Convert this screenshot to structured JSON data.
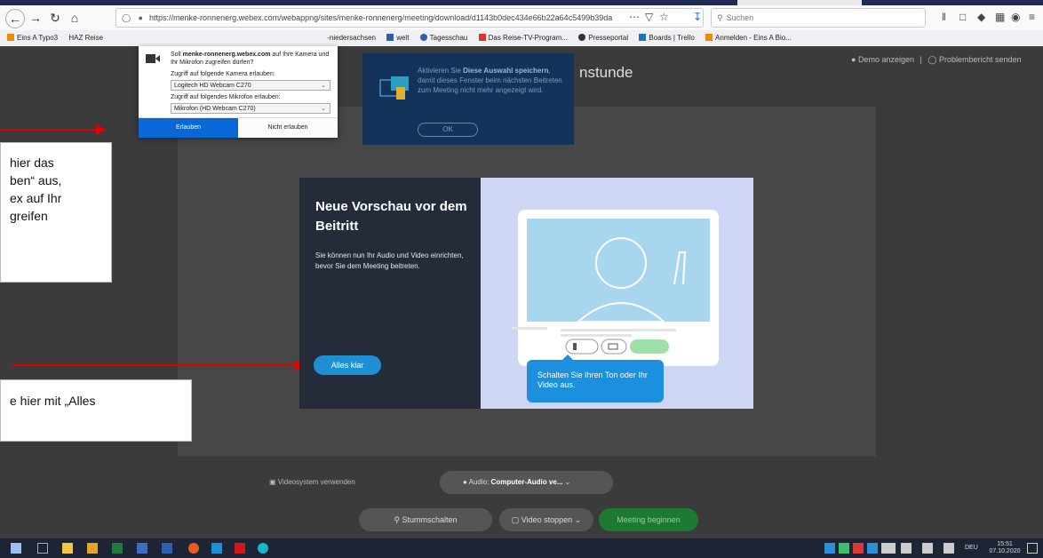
{
  "browser": {
    "url": "https://menke-ronnenerg.webex.com/webappng/sites/menke-ronnenerg/meeting/download/d1143b0dec434e66b22a64c5499b39da",
    "search_placeholder": "Suchen",
    "bookmarks": [
      "Eins A Typo3",
      "HAZ Reise",
      "-niedersachsen",
      "welt",
      "Tagesschau",
      "Das Reise-TV-Program...",
      "Presseportal",
      "Boards | Trello",
      "Anmelden - Eins A Bio..."
    ]
  },
  "permission_popup": {
    "message_prefix": "Soll",
    "message_domain": "menke-ronnenerg.webex.com",
    "message_suffix": "auf Ihre Kamera und Ihr Mikrofon zugreifen dürfen?",
    "camera_label": "Zugriff auf folgende Kamera erlauben:",
    "camera_value": "Logitech HD Webcam C270",
    "mic_label": "Zugriff auf folgendes Mikrofon erlauben:",
    "mic_value": "Mikrofon (HD Webcam C270)",
    "allow": "Erlauben",
    "deny": "Nicht erlauben"
  },
  "tip": {
    "text_prefix": "Aktivieren Sie",
    "text_bold": "Diese Auswahl speichern",
    "text_suffix": ", damit dieses Fenster beim nächsten Beitreten zum Meeting nicht mehr angezeigt wird.",
    "ok": "OK"
  },
  "page": {
    "title_fragment": "nstunde",
    "demo_link": "Demo anzeigen",
    "separator": "|",
    "problem_link": "Problembericht senden"
  },
  "callouts": {
    "first_lines": [
      "hier das",
      "ben“ aus,",
      "ex auf Ihr",
      "greifen"
    ],
    "second_lines": [
      "e hier mit „Alles"
    ]
  },
  "preview": {
    "heading": "Neue Vorschau vor dem Beitritt",
    "body": "Sie können nun Ihr Audio und Video einrichten, bevor Sie dem Meeting beitreten.",
    "button": "Alles klar",
    "tooltip": "Schalten Sie Ihren Ton oder Ihr Video aus."
  },
  "controls": {
    "video_system": "Videosystem verwenden",
    "audio_label": "Audio:",
    "audio_value": "Computer-Audio ve...",
    "mute": "Stummschalten",
    "video_stop": "Video stoppen",
    "start": "Meeting beginnen"
  },
  "taskbar": {
    "lang": "DEU",
    "time": "15:51",
    "date": "07.10.2020"
  },
  "colors": {
    "accent": "#0a67d6",
    "start_button": "#1d7a32",
    "callout_arrow": "#e20000"
  }
}
